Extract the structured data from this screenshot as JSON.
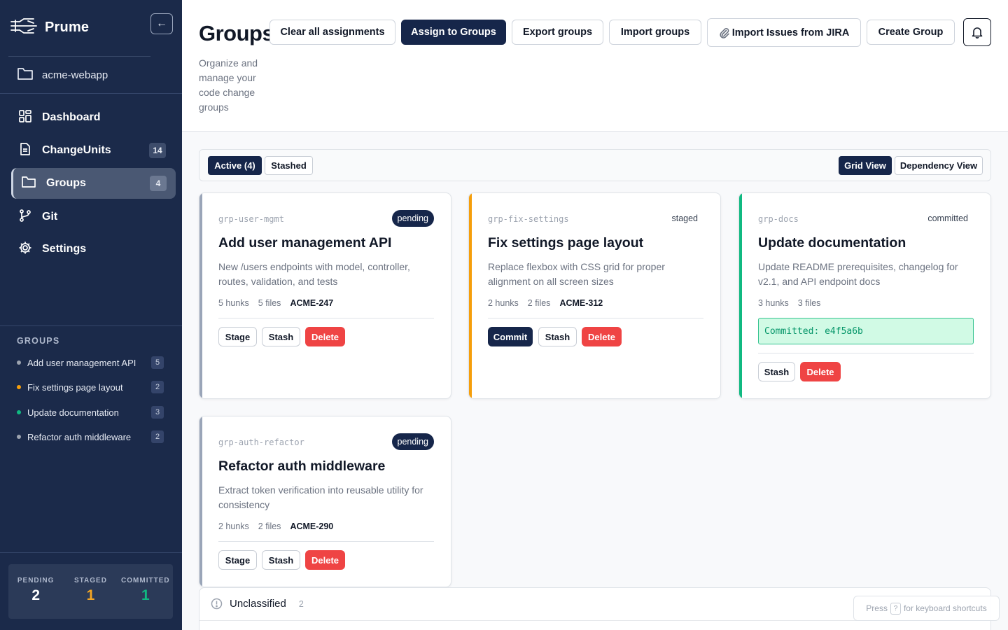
{
  "app": {
    "name": "Prume",
    "collapse_glyph": "←"
  },
  "project": {
    "name": "acme-webapp"
  },
  "nav": {
    "dashboard": {
      "label": "Dashboard"
    },
    "changeunits": {
      "label": "ChangeUnits",
      "badge": "14"
    },
    "groups": {
      "label": "Groups",
      "badge": "4"
    },
    "git": {
      "label": "Git"
    },
    "settings": {
      "label": "Settings"
    }
  },
  "sidebar_groups": {
    "title": "GROUPS",
    "items": [
      {
        "label": "Add user management API",
        "count": "5",
        "color": "#9ca3af"
      },
      {
        "label": "Fix settings page layout",
        "count": "2",
        "color": "#f59e0b"
      },
      {
        "label": "Update documentation",
        "count": "3",
        "color": "#10b981"
      },
      {
        "label": "Refactor auth middleware",
        "count": "2",
        "color": "#9ca3af"
      }
    ]
  },
  "stats": {
    "pending": {
      "label": "PENDING",
      "value": "2",
      "color": "#ffffff"
    },
    "staged": {
      "label": "STAGED",
      "value": "1",
      "color": "#f5a623"
    },
    "committed": {
      "label": "COMMITTED",
      "value": "1",
      "color": "#10b981"
    }
  },
  "header": {
    "title": "Groups",
    "subtitle": "Organize and manage your code change groups",
    "buttons": {
      "clear": "Clear all assignments",
      "assign": "Assign to Groups",
      "export": "Export groups",
      "import": "Import groups",
      "jira": "Import Issues from JIRA",
      "create": "Create Group"
    }
  },
  "tabs": {
    "active": "Active (4)",
    "stashed": "Stashed",
    "grid_view": "Grid View",
    "dependency_view": "Dependency View"
  },
  "cards": [
    {
      "slug": "grp-user-mgmt",
      "status": "pending",
      "title": "Add user management API",
      "description": "New /users endpoints with model, controller, routes, validation, and tests",
      "hunks": "5 hunks",
      "files": "5 files",
      "ticket": "ACME-247",
      "accent": "#9aa5b8",
      "actions": [
        "Stage",
        "Stash",
        "Delete"
      ]
    },
    {
      "slug": "grp-fix-settings",
      "status": "staged",
      "title": "Fix settings page layout",
      "description": "Replace flexbox with CSS grid for proper alignment on all screen sizes",
      "hunks": "2 hunks",
      "files": "2 files",
      "ticket": "ACME-312",
      "accent": "#f59e0b",
      "actions": [
        "Commit",
        "Stash",
        "Delete"
      ]
    },
    {
      "slug": "grp-docs",
      "status": "committed",
      "title": "Update documentation",
      "description": "Update README prerequisites, changelog for v2.1, and API endpoint docs",
      "hunks": "3 hunks",
      "files": "3 files",
      "ticket": "",
      "committed": "Committed: e4f5a6b",
      "accent": "#10b981",
      "actions": [
        "Stash",
        "Delete"
      ]
    },
    {
      "slug": "grp-auth-refactor",
      "status": "pending",
      "title": "Refactor auth middleware",
      "description": "Extract token verification into reusable utility for consistency",
      "hunks": "2 hunks",
      "files": "2 files",
      "ticket": "ACME-290",
      "accent": "#9aa5b8",
      "actions": [
        "Stage",
        "Stash",
        "Delete"
      ]
    }
  ],
  "unclassified": {
    "label": "Unclassified",
    "count": "2"
  },
  "shortcut_hint": {
    "prefix": "Press",
    "key": "?",
    "suffix": "for keyboard shortcuts"
  },
  "icons": {
    "brand": "prume-logo-icon",
    "project": "folder-icon",
    "dashboard": "grid-icon",
    "changeunits": "document-icon",
    "groups": "folder-icon",
    "git": "git-branch-icon",
    "settings": "gear-icon",
    "bell": "bell-icon",
    "jira": "paperclip-icon",
    "unclassified": "info-icon"
  }
}
